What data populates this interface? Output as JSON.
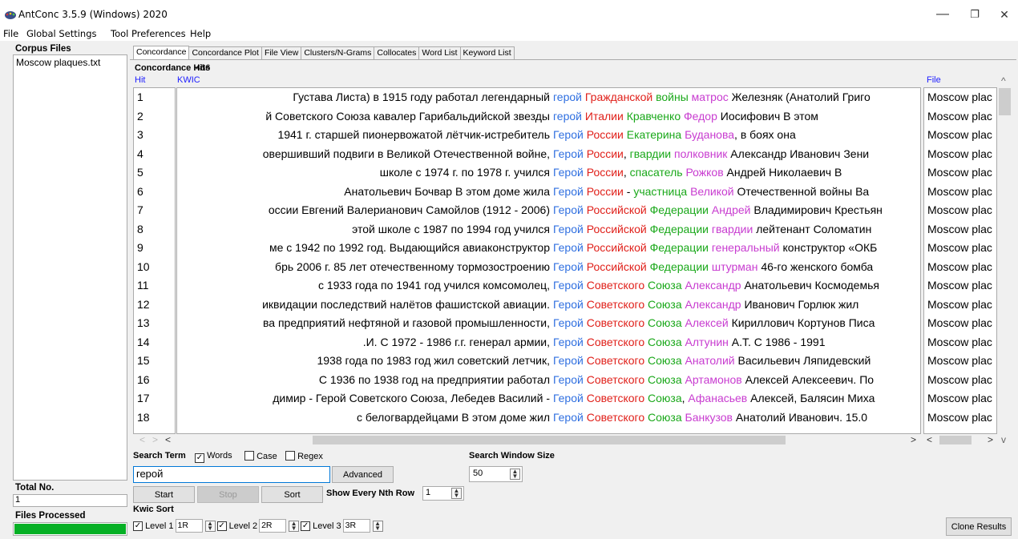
{
  "window": {
    "title": "AntConc 3.5.9 (Windows) 2020",
    "min": "—",
    "max": "❐",
    "close": "✕"
  },
  "menu": [
    "File",
    "Global Settings",
    "Tool Preferences",
    "Help"
  ],
  "corpus": {
    "header": "Corpus Files",
    "files": [
      "Moscow plaques.txt"
    ]
  },
  "total": {
    "label": "Total No.",
    "value": "1"
  },
  "files_processed": {
    "label": "Files Processed",
    "progress": 1.0
  },
  "tabs": [
    "Concordance",
    "Concordance Plot",
    "File View",
    "Clusters/N-Grams",
    "Collocates",
    "Word List",
    "Keyword List"
  ],
  "hits": {
    "label": "Concordance Hits",
    "count": "466"
  },
  "columns": {
    "hit": "Hit",
    "kwic": "KWIC",
    "file": "File"
  },
  "colors": {
    "blue": "#2f6fe0",
    "red": "#e0201a",
    "green": "#1aa81a",
    "magenta": "#c83cd0"
  },
  "rows": [
    {
      "n": "1",
      "left": "Густава Листа) в 1915 году работал легендарный",
      "segs": [
        [
          "герой",
          "blue"
        ],
        [
          " ",
          ""
        ],
        [
          "Гражданской",
          "red"
        ],
        [
          " ",
          ""
        ],
        [
          "войны",
          "green"
        ],
        [
          " ",
          ""
        ],
        [
          "матрос",
          "magenta"
        ],
        [
          " Железняк (Анатолий Григо",
          ""
        ]
      ],
      "file": "Moscow plac"
    },
    {
      "n": "2",
      "left": "й Советского Союза кавалер Гарибальдийской звезды",
      "segs": [
        [
          "герой",
          "blue"
        ],
        [
          " ",
          ""
        ],
        [
          "Италии",
          "red"
        ],
        [
          " ",
          ""
        ],
        [
          "Кравченко",
          "green"
        ],
        [
          " ",
          ""
        ],
        [
          "Федор",
          "magenta"
        ],
        [
          " Иосифович В этом",
          ""
        ]
      ],
      "file": "Moscow plac"
    },
    {
      "n": "3",
      "left": "1941 г. старшей пионервожатой лётчик-истребитель",
      "segs": [
        [
          "Герой",
          "blue"
        ],
        [
          " ",
          ""
        ],
        [
          "России",
          "red"
        ],
        [
          " ",
          ""
        ],
        [
          "Екатерина",
          "green"
        ],
        [
          " ",
          ""
        ],
        [
          "Буданова",
          "magenta"
        ],
        [
          ", в боях она",
          ""
        ]
      ],
      "file": "Moscow plac"
    },
    {
      "n": "4",
      "left": "овершивший подвиги в Великой Отечественной войне,",
      "segs": [
        [
          "Герой",
          "blue"
        ],
        [
          " ",
          ""
        ],
        [
          "России",
          "red"
        ],
        [
          ", ",
          ""
        ],
        [
          "гвардии",
          "green"
        ],
        [
          " ",
          ""
        ],
        [
          "полковник",
          "magenta"
        ],
        [
          " Александр Иванович Зени",
          ""
        ]
      ],
      "file": "Moscow plac"
    },
    {
      "n": "5",
      "left": "школе с 1974 г. по 1978 г. учился",
      "segs": [
        [
          "Герой",
          "blue"
        ],
        [
          " ",
          ""
        ],
        [
          "России",
          "red"
        ],
        [
          ", ",
          ""
        ],
        [
          "спасатель",
          "green"
        ],
        [
          " ",
          ""
        ],
        [
          "Рожков",
          "magenta"
        ],
        [
          " Андрей Николаевич В",
          ""
        ]
      ],
      "file": "Moscow plac"
    },
    {
      "n": "6",
      "left": "Анатольевич Бочвар В этом доме жила",
      "segs": [
        [
          "Герой",
          "blue"
        ],
        [
          " ",
          ""
        ],
        [
          "России",
          "red"
        ],
        [
          " - ",
          ""
        ],
        [
          "участница",
          "green"
        ],
        [
          " ",
          ""
        ],
        [
          "Великой",
          "magenta"
        ],
        [
          " Отечественной войны Ва",
          ""
        ]
      ],
      "file": "Moscow plac"
    },
    {
      "n": "7",
      "left": "оссии Евгений Валерианович Самойлов (1912 - 2006)",
      "segs": [
        [
          "Герой",
          "blue"
        ],
        [
          " ",
          ""
        ],
        [
          "Российской",
          "red"
        ],
        [
          " ",
          ""
        ],
        [
          "Федерации",
          "green"
        ],
        [
          " ",
          ""
        ],
        [
          "Андрей",
          "magenta"
        ],
        [
          " Владимирович Крестьян",
          ""
        ]
      ],
      "file": "Moscow plac"
    },
    {
      "n": "8",
      "left": "этой школе с 1987 по 1994 год учился",
      "segs": [
        [
          "Герой",
          "blue"
        ],
        [
          " ",
          ""
        ],
        [
          "Российской",
          "red"
        ],
        [
          " ",
          ""
        ],
        [
          "Федерации",
          "green"
        ],
        [
          " ",
          ""
        ],
        [
          "гвардии",
          "magenta"
        ],
        [
          " лейтенант Соломатин",
          ""
        ]
      ],
      "file": "Moscow plac"
    },
    {
      "n": "9",
      "left": "ме с 1942 по 1992 год. Выдающийся авиаконструктор",
      "segs": [
        [
          "Герой",
          "blue"
        ],
        [
          " ",
          ""
        ],
        [
          "Российской",
          "red"
        ],
        [
          " ",
          ""
        ],
        [
          "Федерации",
          "green"
        ],
        [
          " ",
          ""
        ],
        [
          "генеральный",
          "magenta"
        ],
        [
          " конструктор «ОКБ",
          ""
        ]
      ],
      "file": "Moscow plac"
    },
    {
      "n": "10",
      "left": "брь 2006 г. 85 лет отечественному тормозостроению",
      "segs": [
        [
          "Герой",
          "blue"
        ],
        [
          " ",
          ""
        ],
        [
          "Российской",
          "red"
        ],
        [
          " ",
          ""
        ],
        [
          "Федерации",
          "green"
        ],
        [
          " ",
          ""
        ],
        [
          "штурман",
          "magenta"
        ],
        [
          " 46-го женского бомба",
          ""
        ]
      ],
      "file": "Moscow plac"
    },
    {
      "n": "11",
      "left": "с 1933 года по 1941 год учился комсомолец,",
      "segs": [
        [
          "Герой",
          "blue"
        ],
        [
          " ",
          ""
        ],
        [
          "Советского",
          "red"
        ],
        [
          " ",
          ""
        ],
        [
          "Союза",
          "green"
        ],
        [
          " ",
          ""
        ],
        [
          "Александр",
          "magenta"
        ],
        [
          " Анатольевич Космодемья",
          ""
        ]
      ],
      "file": "Moscow plac"
    },
    {
      "n": "12",
      "left": "иквидации последствий налётов фашистской авиации.",
      "segs": [
        [
          "Герой",
          "blue"
        ],
        [
          " ",
          ""
        ],
        [
          "Советского",
          "red"
        ],
        [
          " ",
          ""
        ],
        [
          "Союза",
          "green"
        ],
        [
          " ",
          ""
        ],
        [
          "Александр",
          "magenta"
        ],
        [
          " Иванович Горлюк жил",
          ""
        ]
      ],
      "file": "Moscow plac"
    },
    {
      "n": "13",
      "left": "ва предприятий нефтяной и газовой промышленности,",
      "segs": [
        [
          "Герой",
          "blue"
        ],
        [
          " ",
          ""
        ],
        [
          "Советского",
          "red"
        ],
        [
          " ",
          ""
        ],
        [
          "Союза",
          "green"
        ],
        [
          " ",
          ""
        ],
        [
          "Алексей",
          "magenta"
        ],
        [
          " Кириллович Кортунов Писа",
          ""
        ]
      ],
      "file": "Moscow plac"
    },
    {
      "n": "14",
      "left": ".И. С 1972 - 1986 г.г. генерал армии,",
      "segs": [
        [
          "Герой",
          "blue"
        ],
        [
          " ",
          ""
        ],
        [
          "Советского",
          "red"
        ],
        [
          " ",
          ""
        ],
        [
          "Союза",
          "green"
        ],
        [
          " ",
          ""
        ],
        [
          "Алтунин",
          "magenta"
        ],
        [
          " А.Т. С 1986 - 1991",
          ""
        ]
      ],
      "file": "Moscow plac"
    },
    {
      "n": "15",
      "left": "1938 года по 1983 год жил советский летчик,",
      "segs": [
        [
          "Герой",
          "blue"
        ],
        [
          " ",
          ""
        ],
        [
          "Советского",
          "red"
        ],
        [
          " ",
          ""
        ],
        [
          "Союза",
          "green"
        ],
        [
          " ",
          ""
        ],
        [
          "Анатолий",
          "magenta"
        ],
        [
          " Васильевич Ляпидевский",
          ""
        ]
      ],
      "file": "Moscow plac"
    },
    {
      "n": "16",
      "left": "С 1936 по 1938 год на предприятии работал",
      "segs": [
        [
          "Герой",
          "blue"
        ],
        [
          " ",
          ""
        ],
        [
          "Советского",
          "red"
        ],
        [
          " ",
          ""
        ],
        [
          "Союза",
          "green"
        ],
        [
          " ",
          ""
        ],
        [
          "Артамонов",
          "magenta"
        ],
        [
          " Алексей Алексеевич. По",
          ""
        ]
      ],
      "file": "Moscow plac"
    },
    {
      "n": "17",
      "left": "димир - Герой Советского Союза, Лебедев Василий -",
      "segs": [
        [
          "Герой",
          "blue"
        ],
        [
          " ",
          ""
        ],
        [
          "Советского",
          "red"
        ],
        [
          " ",
          ""
        ],
        [
          "Союза",
          "green"
        ],
        [
          ", ",
          ""
        ],
        [
          "Афанасьев",
          "magenta"
        ],
        [
          " Алексей, Балясин Миха",
          ""
        ]
      ],
      "file": "Moscow plac"
    },
    {
      "n": "18",
      "left": "с белогвардейцами В этом доме жил",
      "segs": [
        [
          "Герой",
          "blue"
        ],
        [
          " ",
          ""
        ],
        [
          "Советского",
          "red"
        ],
        [
          " ",
          ""
        ],
        [
          "Союза",
          "green"
        ],
        [
          " ",
          ""
        ],
        [
          "Банкузов",
          "magenta"
        ],
        [
          " Анатолий Иванович. 15.0",
          ""
        ]
      ],
      "file": "Moscow plac"
    }
  ],
  "search": {
    "label": "Search Term",
    "words": {
      "label": "Words",
      "checked": true
    },
    "case": {
      "label": "Case",
      "checked": false
    },
    "regex": {
      "label": "Regex",
      "checked": false
    },
    "value": "герой",
    "advanced": "Advanced",
    "window_label": "Search Window Size",
    "window_value": "50",
    "start": "Start",
    "stop": "Stop",
    "sort": "Sort",
    "nth_label": "Show Every Nth Row",
    "nth_value": "1"
  },
  "kwic_sort": {
    "label": "Kwic Sort",
    "levels": [
      {
        "label": "Level 1",
        "value": "1R"
      },
      {
        "label": "Level 2",
        "value": "2R"
      },
      {
        "label": "Level 3",
        "value": "3R"
      }
    ]
  },
  "clone": "Clone Results"
}
